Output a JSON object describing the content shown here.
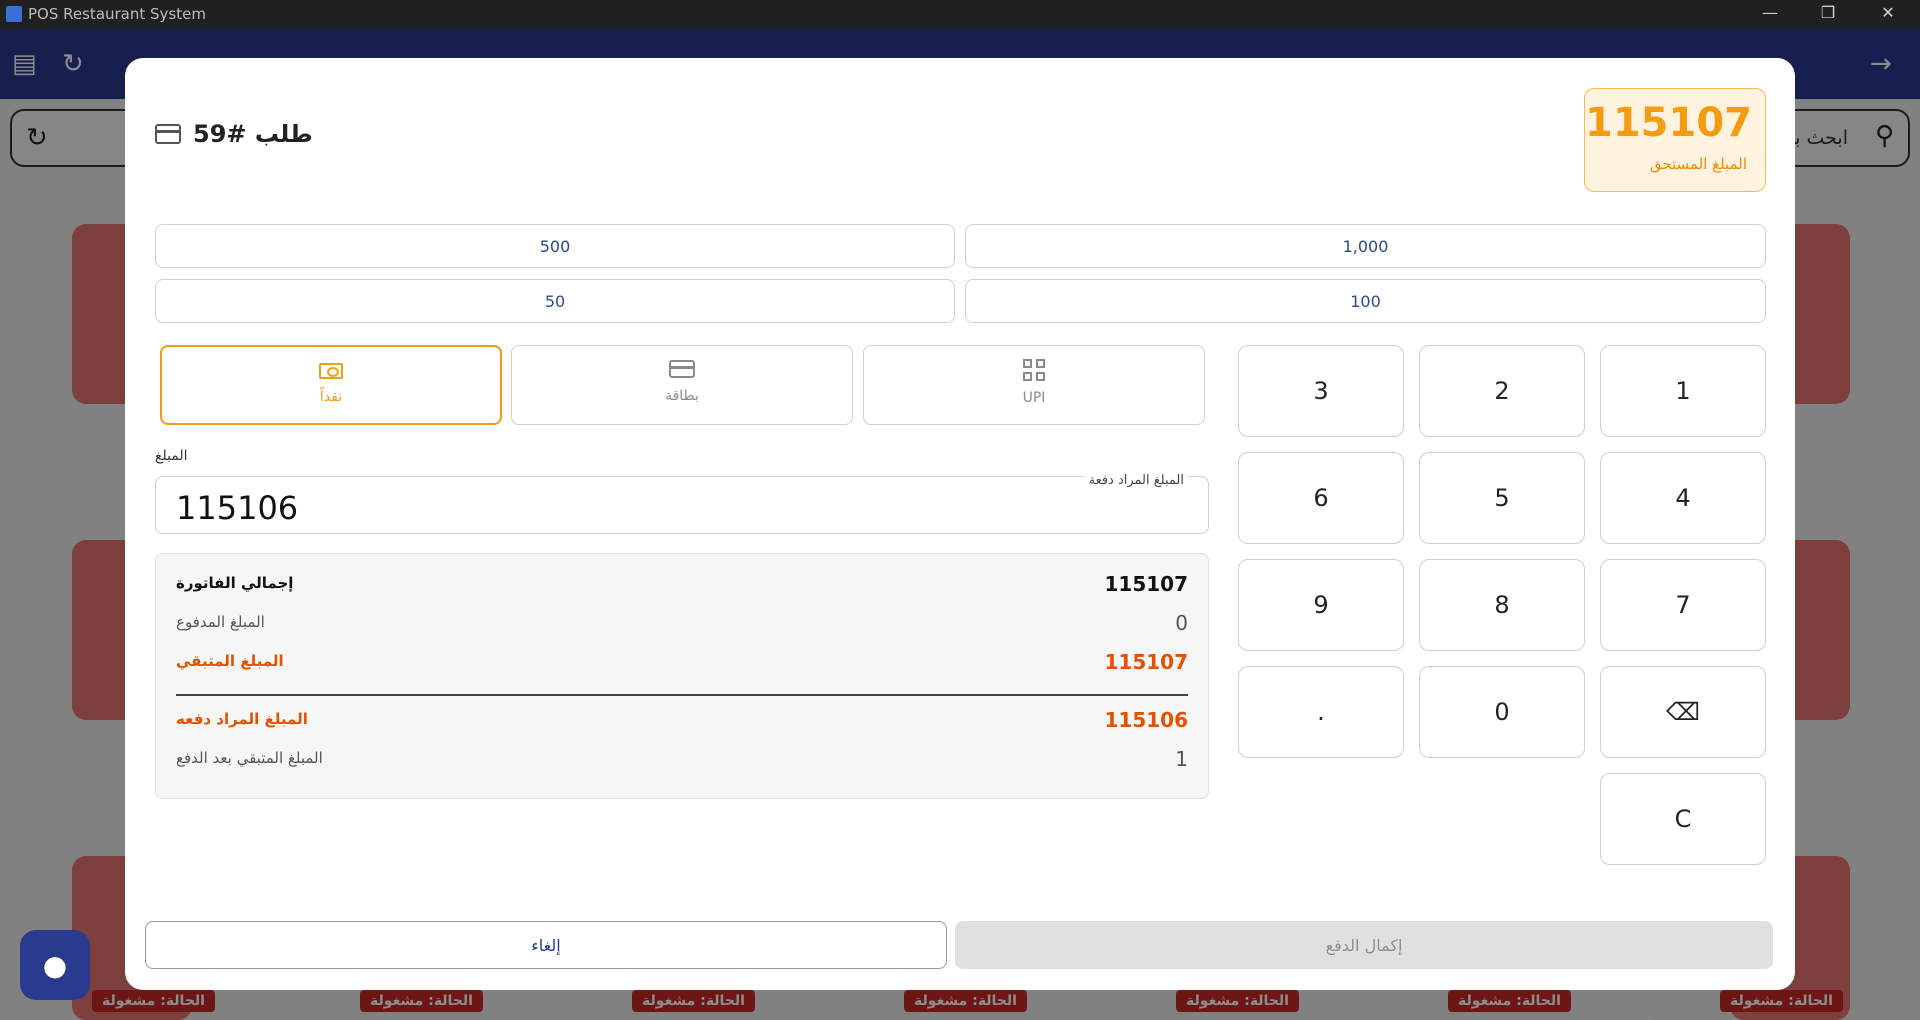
{
  "window": {
    "title": "POS Restaurant System"
  },
  "app": {
    "search_placeholder": "ابحث بر",
    "table_status": "الحالة: مشغولة"
  },
  "dialog": {
    "order_title": "طلب #59",
    "amount_due": "115107",
    "amount_due_label": "المبلغ المستحق",
    "quick_amounts": [
      "500",
      "1,000",
      "50",
      "100"
    ],
    "payment_methods": [
      {
        "label": "نقداً",
        "icon": "cash-icon",
        "active": true
      },
      {
        "label": "بطاقة",
        "icon": "card-icon",
        "active": false
      },
      {
        "label": "UPI",
        "icon": "qr-code-icon",
        "active": false
      }
    ],
    "amount_caption": "المبلغ",
    "amount_hint": "المبلغ المراد دفعة",
    "amount_value": "115106",
    "summary": {
      "invoice_total_label": "إجمالي الفاتورة",
      "invoice_total": "115107",
      "paid_label": "المبلغ المدفوع",
      "paid": "0",
      "remaining_label": "المبلغ المتبقي",
      "remaining": "115107",
      "to_pay_label": "المبلغ المراد دفعه",
      "to_pay": "115106",
      "remaining_after_label": "المبلغ المتبقي بعد الدفع",
      "remaining_after": "1"
    },
    "keypad": {
      "k1": "1",
      "k2": "2",
      "k3": "3",
      "k4": "4",
      "k5": "5",
      "k6": "6",
      "k7": "7",
      "k8": "8",
      "k9": "9",
      "k0": "0",
      "kdot": ".",
      "kback": "⌫",
      "kclear": "C"
    },
    "cancel_label": "إلغاء",
    "complete_label": "إكمال الدفع"
  },
  "colors": {
    "accent_orange": "#f39c12",
    "remaining_orange": "#e65100",
    "app_bar": "#2a3a8f"
  }
}
